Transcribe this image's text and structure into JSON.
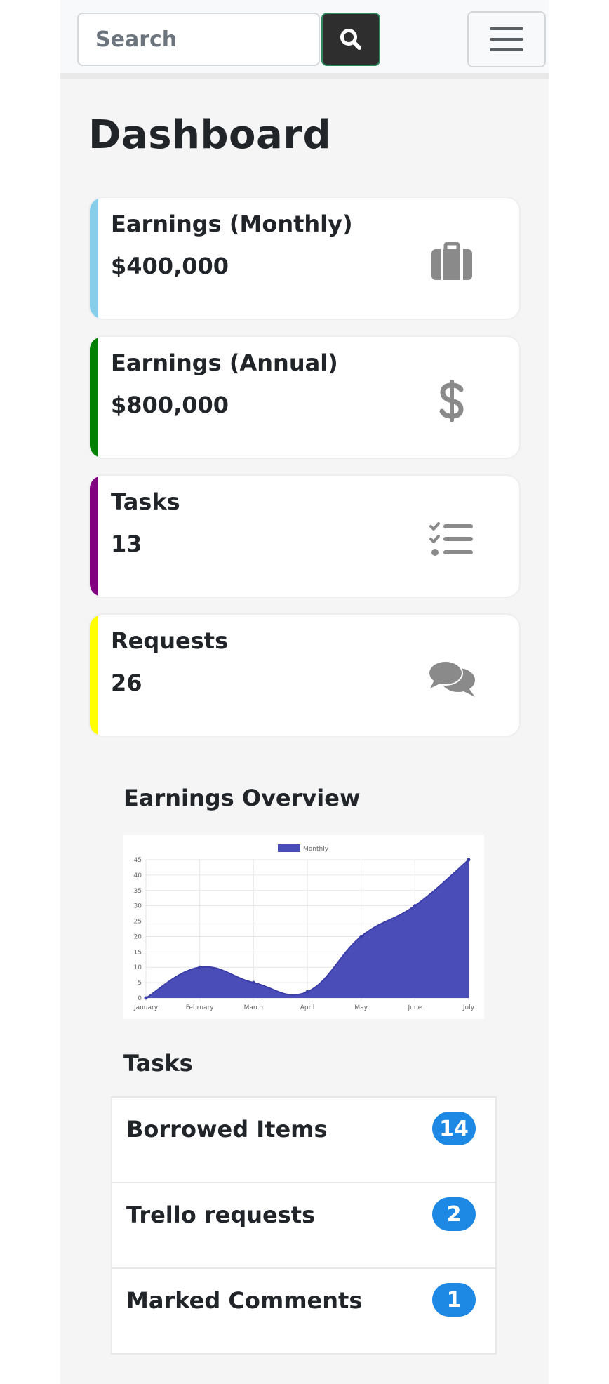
{
  "navbar": {
    "search_placeholder": "Search",
    "search_icon": "search-icon",
    "menu_icon": "hamburger-icon"
  },
  "page_title": "Dashboard",
  "stats": [
    {
      "label": "Earnings (Monthly)",
      "value": "$400,000",
      "accent": "#87ceeb",
      "icon": "briefcase-icon"
    },
    {
      "label": "Earnings (Annual)",
      "value": "$800,000",
      "accent": "#008000",
      "icon": "dollar-icon"
    },
    {
      "label": "Tasks",
      "value": "13",
      "accent": "#800080",
      "icon": "task-list-icon"
    },
    {
      "label": "Requests",
      "value": "26",
      "accent": "#ffff00",
      "icon": "comments-icon"
    }
  ],
  "earnings_overview": {
    "title": "Earnings Overview"
  },
  "chart_data": {
    "type": "area",
    "title": "",
    "xlabel": "",
    "ylabel": "",
    "categories": [
      "January",
      "February",
      "March",
      "April",
      "May",
      "June",
      "July"
    ],
    "series": [
      {
        "name": "Monthly",
        "values": [
          0,
          10,
          5,
          2,
          20,
          30,
          45
        ],
        "color": "#4a4db8"
      }
    ],
    "ylim": [
      0,
      45
    ],
    "yticks": [
      0,
      5,
      10,
      15,
      20,
      25,
      30,
      35,
      40,
      45
    ],
    "grid": true,
    "legend": "top-center"
  },
  "tasks_section": {
    "title": "Tasks",
    "items": [
      {
        "label": "Borrowed Items",
        "count": "14"
      },
      {
        "label": "Trello requests",
        "count": "2"
      },
      {
        "label": "Marked Comments",
        "count": "1"
      }
    ]
  },
  "colors": {
    "badge": "#1e88e5",
    "icon_gray": "#8a8a8a"
  }
}
